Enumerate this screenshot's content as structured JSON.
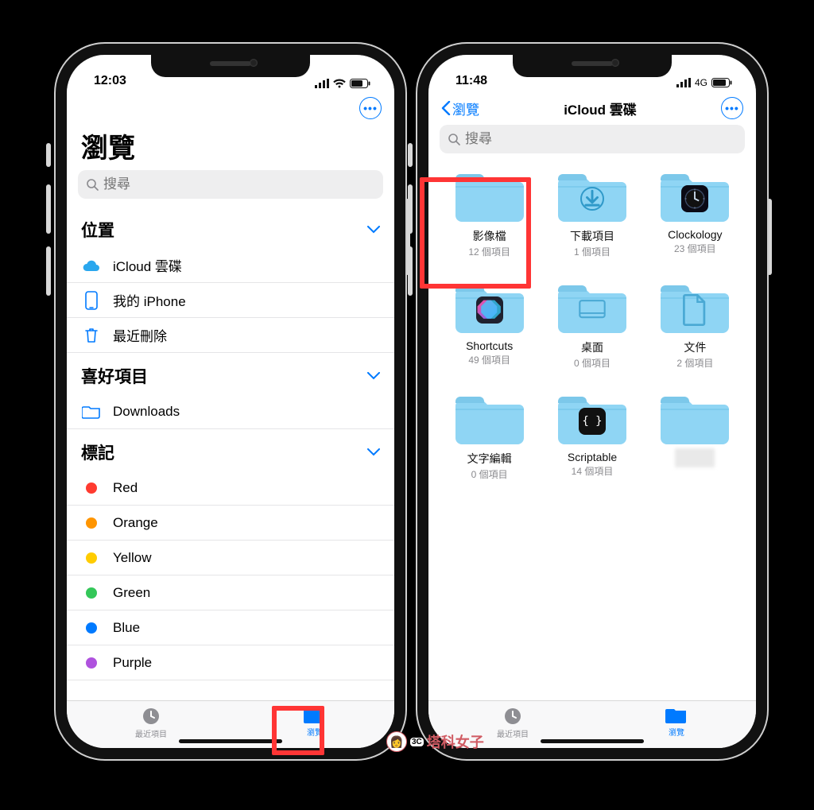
{
  "colors": {
    "accent": "#007aff",
    "folder": "#8fd5f4",
    "folderDark": "#6bc1e6",
    "highlight": "#ff3535",
    "tagRed": "#ff3b30",
    "tagOrange": "#ff9500",
    "tagYellow": "#ffcc00",
    "tagGreen": "#34c759",
    "tagBlue": "#007aff",
    "tagPurple": "#af52de"
  },
  "left": {
    "status": {
      "time": "12:03",
      "network": "wifi"
    },
    "moreIcon": "ellipsis",
    "title": "瀏覽",
    "searchPlaceholder": "搜尋",
    "sections": {
      "locationsTitle": "位置",
      "locations": [
        {
          "icon": "cloud-icon",
          "label": "iCloud 雲碟"
        },
        {
          "icon": "iphone-icon",
          "label": "我的 iPhone"
        },
        {
          "icon": "trash-icon",
          "label": "最近刪除"
        }
      ],
      "favoritesTitle": "喜好項目",
      "favorites": [
        {
          "icon": "folder-icon",
          "label": "Downloads"
        }
      ],
      "tagsTitle": "標記",
      "tags": [
        {
          "color": "tagRed",
          "label": "Red"
        },
        {
          "color": "tagOrange",
          "label": "Orange"
        },
        {
          "color": "tagYellow",
          "label": "Yellow"
        },
        {
          "color": "tagGreen",
          "label": "Green"
        },
        {
          "color": "tagBlue",
          "label": "Blue"
        },
        {
          "color": "tagPurple",
          "label": "Purple"
        }
      ]
    },
    "tabs": {
      "recent": "最近項目",
      "browse": "瀏覽"
    }
  },
  "right": {
    "status": {
      "time": "11:48",
      "network": "4G"
    },
    "backLabel": "瀏覽",
    "title": "iCloud 雲碟",
    "searchPlaceholder": "搜尋",
    "items": [
      {
        "name": "影像檔",
        "sub": "12 個項目",
        "overlay": null
      },
      {
        "name": "下載項目",
        "sub": "1 個項目",
        "overlay": "download"
      },
      {
        "name": "Clockology",
        "sub": "23 個項目",
        "overlay": "watchface"
      },
      {
        "name": "Shortcuts",
        "sub": "49 個項目",
        "overlay": "shortcuts"
      },
      {
        "name": "桌面",
        "sub": "0 個項目",
        "overlay": "desktop-glyph"
      },
      {
        "name": "文件",
        "sub": "2 個項目",
        "overlay": "doc-glyph"
      },
      {
        "name": "文字編輯",
        "sub": "0 個項目",
        "overlay": null
      },
      {
        "name": "Scriptable",
        "sub": "14 個項目",
        "overlay": "scriptable"
      },
      {
        "name": "",
        "sub": "",
        "overlay": "blur"
      }
    ],
    "tabs": {
      "recent": "最近項目",
      "browse": "瀏覽"
    }
  },
  "watermark": "塔科女子"
}
